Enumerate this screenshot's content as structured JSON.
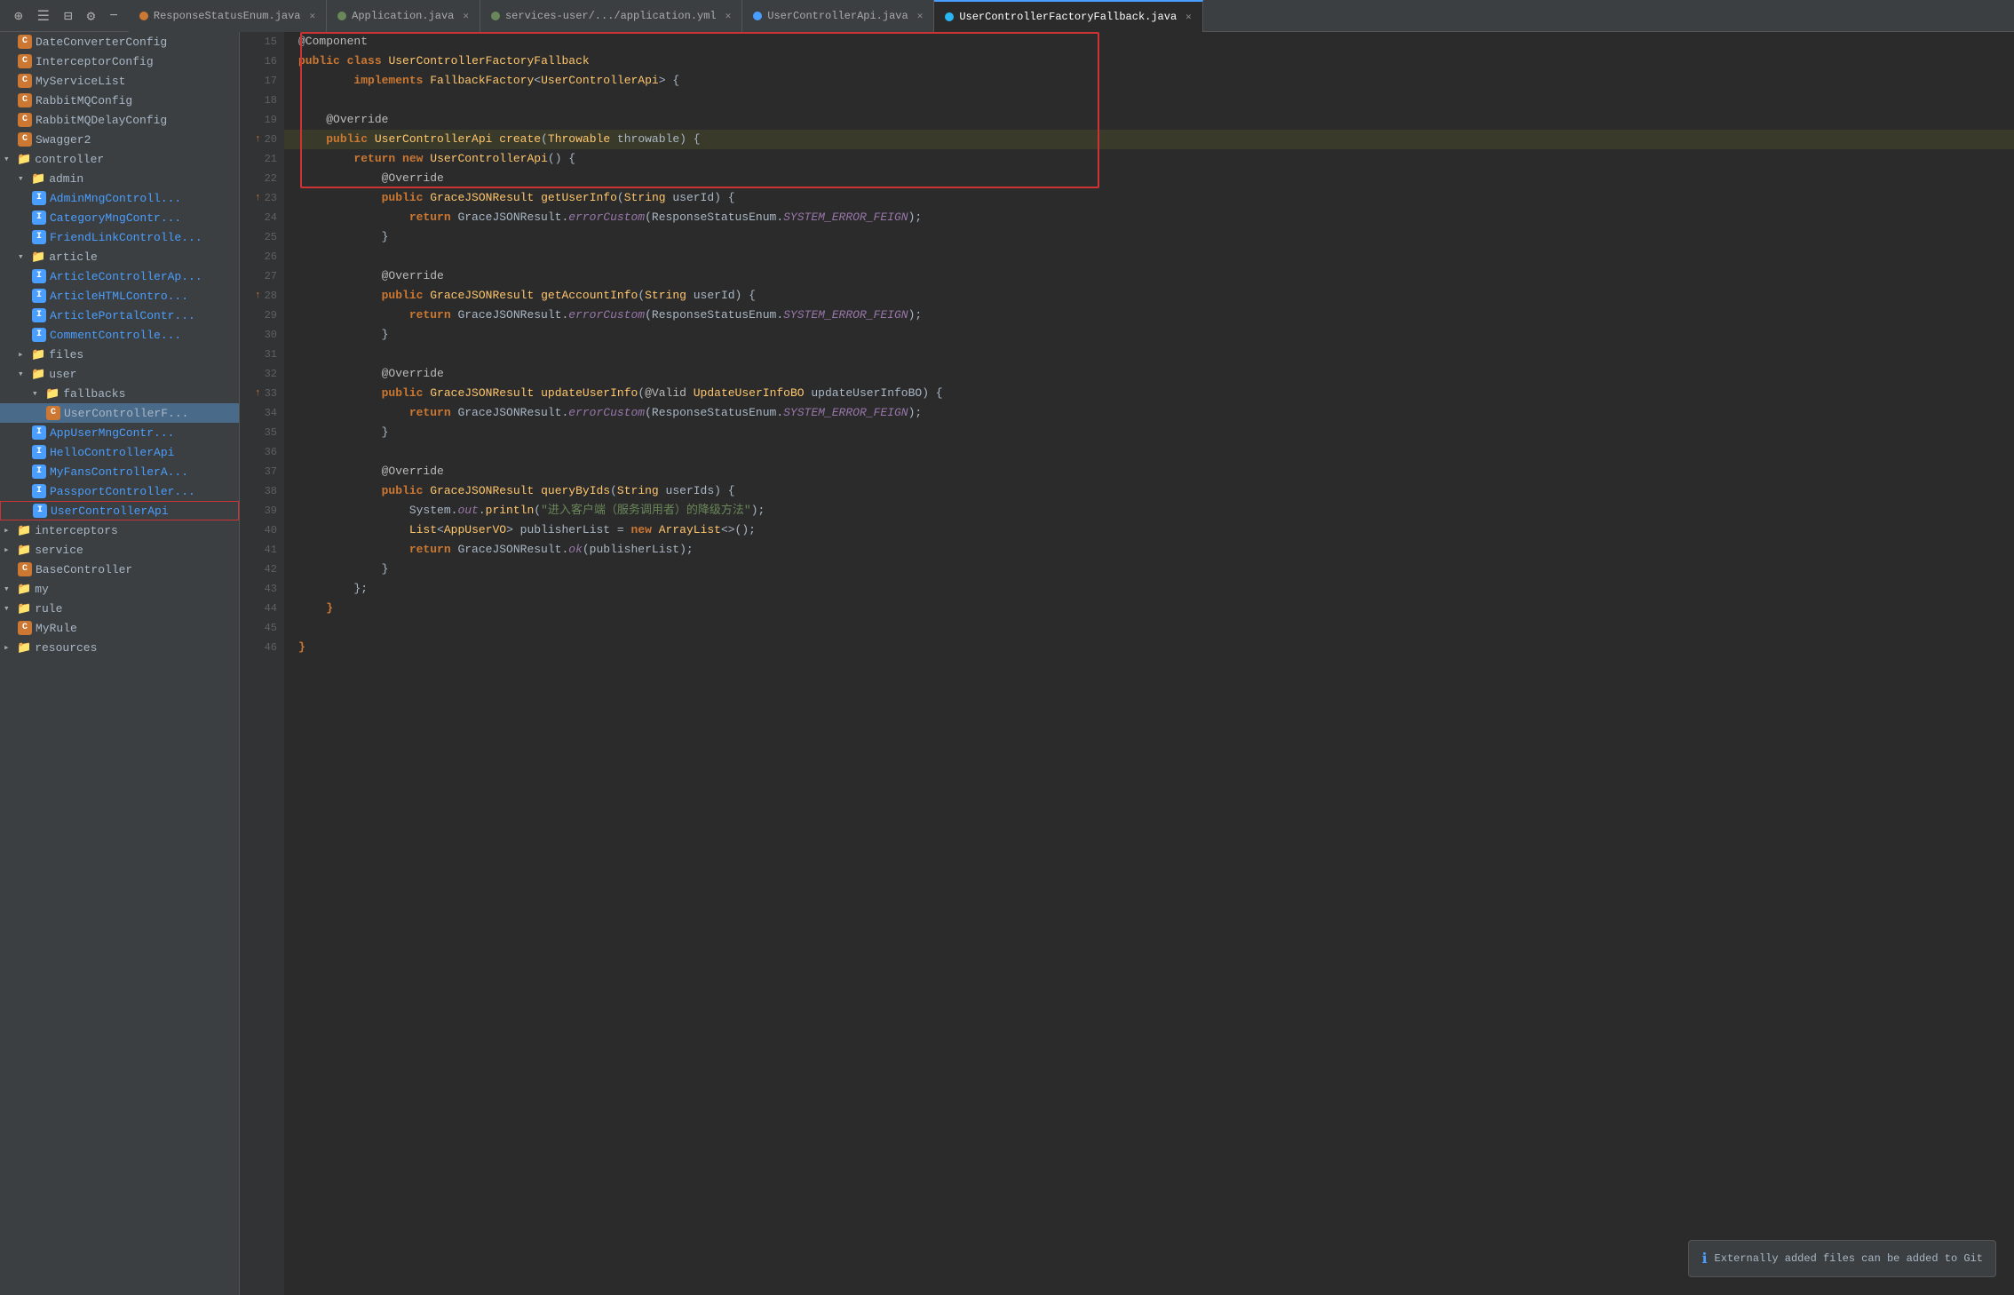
{
  "tabs": [
    {
      "id": "tab1",
      "label": "ResponseStatusEnum.java",
      "dot": "orange",
      "active": false
    },
    {
      "id": "tab2",
      "label": "Application.java",
      "dot": "green",
      "active": false
    },
    {
      "id": "tab3",
      "label": "services-user/.../application.yml",
      "dot": "green",
      "active": false
    },
    {
      "id": "tab4",
      "label": "UserControllerApi.java",
      "dot": "blue",
      "active": false
    },
    {
      "id": "tab5",
      "label": "UserControllerFactoryFallback.java",
      "dot": "cyan",
      "active": true
    }
  ],
  "sidebar": {
    "items": [
      {
        "id": "DateConverterConfig",
        "indent": 1,
        "type": "class",
        "label": "DateConverterConfig",
        "badge": "C"
      },
      {
        "id": "InterceptorConfig",
        "indent": 1,
        "type": "class",
        "label": "InterceptorConfig",
        "badge": "C"
      },
      {
        "id": "MyServiceList",
        "indent": 1,
        "type": "class",
        "label": "MyServiceList",
        "badge": "C"
      },
      {
        "id": "RabbitMQConfig",
        "indent": 1,
        "type": "class",
        "label": "RabbitMQConfig",
        "badge": "C"
      },
      {
        "id": "RabbitMQDelayConfig",
        "indent": 1,
        "type": "class",
        "label": "RabbitMQDelayConfig",
        "badge": "C"
      },
      {
        "id": "Swagger2",
        "indent": 1,
        "type": "class",
        "label": "Swagger2",
        "badge": "C"
      },
      {
        "id": "controller",
        "indent": 0,
        "type": "folder",
        "label": "controller",
        "open": true
      },
      {
        "id": "admin",
        "indent": 1,
        "type": "folder",
        "label": "admin",
        "open": true
      },
      {
        "id": "AdminMngController",
        "indent": 2,
        "type": "interface",
        "label": "AdminMngControll...",
        "badge": "I"
      },
      {
        "id": "CategoryMngContr",
        "indent": 2,
        "type": "interface",
        "label": "CategoryMngContr...",
        "badge": "I"
      },
      {
        "id": "FriendLinkControll",
        "indent": 2,
        "type": "interface",
        "label": "FriendLinkControlle...",
        "badge": "I"
      },
      {
        "id": "article",
        "indent": 1,
        "type": "folder",
        "label": "article",
        "open": true
      },
      {
        "id": "ArticleControllerAp",
        "indent": 2,
        "type": "interface",
        "label": "ArticleControllerAp...",
        "badge": "I"
      },
      {
        "id": "ArticleHTMLContr",
        "indent": 2,
        "type": "interface",
        "label": "ArticleHTMLContro...",
        "badge": "I"
      },
      {
        "id": "ArticlePortalContr",
        "indent": 2,
        "type": "interface",
        "label": "ArticlePortalContr...",
        "badge": "I"
      },
      {
        "id": "CommentController",
        "indent": 2,
        "type": "interface",
        "label": "CommentControlle...",
        "badge": "I"
      },
      {
        "id": "files",
        "indent": 1,
        "type": "folder",
        "label": "files",
        "open": false
      },
      {
        "id": "user",
        "indent": 1,
        "type": "folder",
        "label": "user",
        "open": true
      },
      {
        "id": "fallbacks",
        "indent": 2,
        "type": "folder",
        "label": "fallbacks",
        "open": true
      },
      {
        "id": "UserControllerF",
        "indent": 3,
        "type": "class",
        "label": "UserControllerF...",
        "badge": "C",
        "selected": true
      },
      {
        "id": "AppUserMngContr",
        "indent": 2,
        "type": "interface",
        "label": "AppUserMngContr...",
        "badge": "I"
      },
      {
        "id": "HelloControllerApi",
        "indent": 2,
        "type": "interface",
        "label": "HelloControllerApi",
        "badge": "I"
      },
      {
        "id": "MyFansControllerA",
        "indent": 2,
        "type": "interface",
        "label": "MyFansControllerA...",
        "badge": "I"
      },
      {
        "id": "PassportController",
        "indent": 2,
        "type": "interface",
        "label": "PassportController...",
        "badge": "I"
      },
      {
        "id": "UserControllerApi",
        "indent": 2,
        "type": "interface",
        "label": "UserControllerApi",
        "badge": "I",
        "highlighted": true
      },
      {
        "id": "interceptors",
        "indent": 0,
        "type": "folder",
        "label": "interceptors",
        "open": false
      },
      {
        "id": "service",
        "indent": 0,
        "type": "folder",
        "label": "service",
        "open": false
      },
      {
        "id": "BaseController",
        "indent": 1,
        "type": "class",
        "label": "BaseController",
        "badge": "C"
      },
      {
        "id": "my",
        "indent": 0,
        "type": "folder",
        "label": "my",
        "open": false
      },
      {
        "id": "rule",
        "indent": 0,
        "type": "folder",
        "label": "rule",
        "open": true
      },
      {
        "id": "MyRule",
        "indent": 1,
        "type": "class",
        "label": "MyRule",
        "badge": "C"
      },
      {
        "id": "resources",
        "indent": 0,
        "type": "folder",
        "label": "resources",
        "open": false
      }
    ]
  },
  "code": {
    "lines": [
      {
        "num": 15,
        "content": "@Component",
        "type": "annotation_line"
      },
      {
        "num": 16,
        "content": "public class UserControllerFactoryFallback",
        "type": "class_decl"
      },
      {
        "num": 17,
        "content": "        implements FallbackFactory<UserControllerApi> {",
        "type": "implements"
      },
      {
        "num": 18,
        "content": "",
        "type": "blank"
      },
      {
        "num": 19,
        "content": "    @Override",
        "type": "annotation"
      },
      {
        "num": 20,
        "content": "    public UserControllerApi create(Throwable throwable) {",
        "type": "method_decl",
        "gutter": "arrow"
      },
      {
        "num": 21,
        "content": "        return new UserControllerApi() {",
        "type": "code"
      },
      {
        "num": 22,
        "content": "            @Override",
        "type": "annotation"
      },
      {
        "num": 23,
        "content": "            public GraceJSONResult getUserInfo(String userId) {",
        "type": "code",
        "gutter": "arrow"
      },
      {
        "num": 24,
        "content": "                return GraceJSONResult.errorCustom(ResponseStatusEnum.SYSTEM_ERROR_FEIGN);",
        "type": "code_return"
      },
      {
        "num": 25,
        "content": "            }",
        "type": "code"
      },
      {
        "num": 26,
        "content": "",
        "type": "blank"
      },
      {
        "num": 27,
        "content": "            @Override",
        "type": "annotation"
      },
      {
        "num": 28,
        "content": "            public GraceJSONResult getAccountInfo(String userId) {",
        "type": "code",
        "gutter": "arrow"
      },
      {
        "num": 29,
        "content": "                return GraceJSONResult.errorCustom(ResponseStatusEnum.SYSTEM_ERROR_FEIGN);",
        "type": "code_return"
      },
      {
        "num": 30,
        "content": "            }",
        "type": "code"
      },
      {
        "num": 31,
        "content": "",
        "type": "blank"
      },
      {
        "num": 32,
        "content": "            @Override",
        "type": "annotation"
      },
      {
        "num": 33,
        "content": "            public GraceJSONResult updateUserInfo(@Valid UpdateUserInfoBO updateUserInfoBO) {",
        "type": "code",
        "gutter": "arrow"
      },
      {
        "num": 34,
        "content": "                return GraceJSONResult.errorCustom(ResponseStatusEnum.SYSTEM_ERROR_FEIGN);",
        "type": "code_return"
      },
      {
        "num": 35,
        "content": "            }",
        "type": "code"
      },
      {
        "num": 36,
        "content": "",
        "type": "blank"
      },
      {
        "num": 37,
        "content": "            @Override",
        "type": "annotation"
      },
      {
        "num": 38,
        "content": "            public GraceJSONResult queryByIds(String userIds) {",
        "type": "code"
      },
      {
        "num": 39,
        "content": "                System.out.println(\"进入客户端（服务调用者）的降级方法\");",
        "type": "print"
      },
      {
        "num": 40,
        "content": "                List<AppUserVO> publisherList = new ArrayList<>();",
        "type": "code"
      },
      {
        "num": 41,
        "content": "                return GraceJSONResult.ok(publisherList);",
        "type": "code"
      },
      {
        "num": 42,
        "content": "            }",
        "type": "code"
      },
      {
        "num": 43,
        "content": "        };",
        "type": "code"
      },
      {
        "num": 44,
        "content": "    }",
        "type": "code"
      },
      {
        "num": 45,
        "content": "",
        "type": "blank"
      },
      {
        "num": 46,
        "content": "}",
        "type": "code"
      }
    ]
  },
  "notification": {
    "icon": "ℹ",
    "text": "Externally added files can be added to Git"
  }
}
